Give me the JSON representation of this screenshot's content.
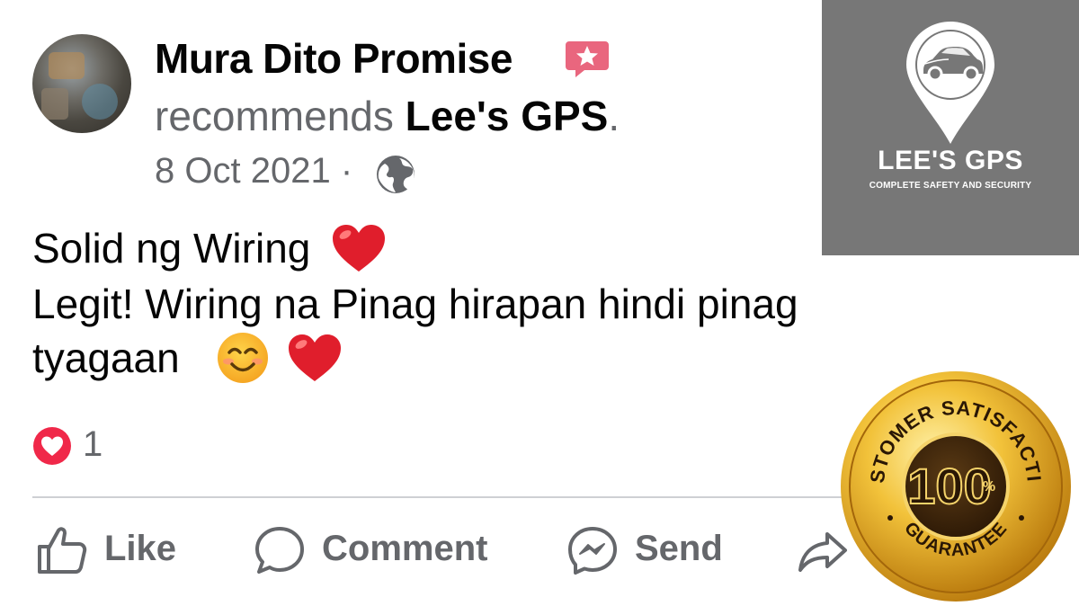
{
  "post": {
    "author": "Mura Dito Promise",
    "recommend_verb": "recommends",
    "page_name": "Lee's GPS",
    "recommend_end": ".",
    "date": "8 Oct 2021",
    "separator": "·",
    "privacy_icon": "globe-icon",
    "lines": [
      "Solid ng Wiring",
      "Legit! Wiring na Pinag hirapan hindi pinag",
      "tyagaan"
    ],
    "reaction_icon": "heart-reaction-icon",
    "reaction_count": "1"
  },
  "actions": {
    "like": "Like",
    "comment": "Comment",
    "send": "Send"
  },
  "brand": {
    "title": "LEE'S GPS",
    "tagline": "COMPLETE SAFETY AND SECURITY",
    "bg_color": "#777777"
  },
  "seal": {
    "top_text": "CUSTOMER SATISFACTION",
    "value": "100",
    "unit": "%",
    "bottom_text": "GUARANTEE",
    "gold": "#e3a91d"
  },
  "colors": {
    "text": "#050505",
    "secondary": "#65676b",
    "heart": "#f02849"
  }
}
